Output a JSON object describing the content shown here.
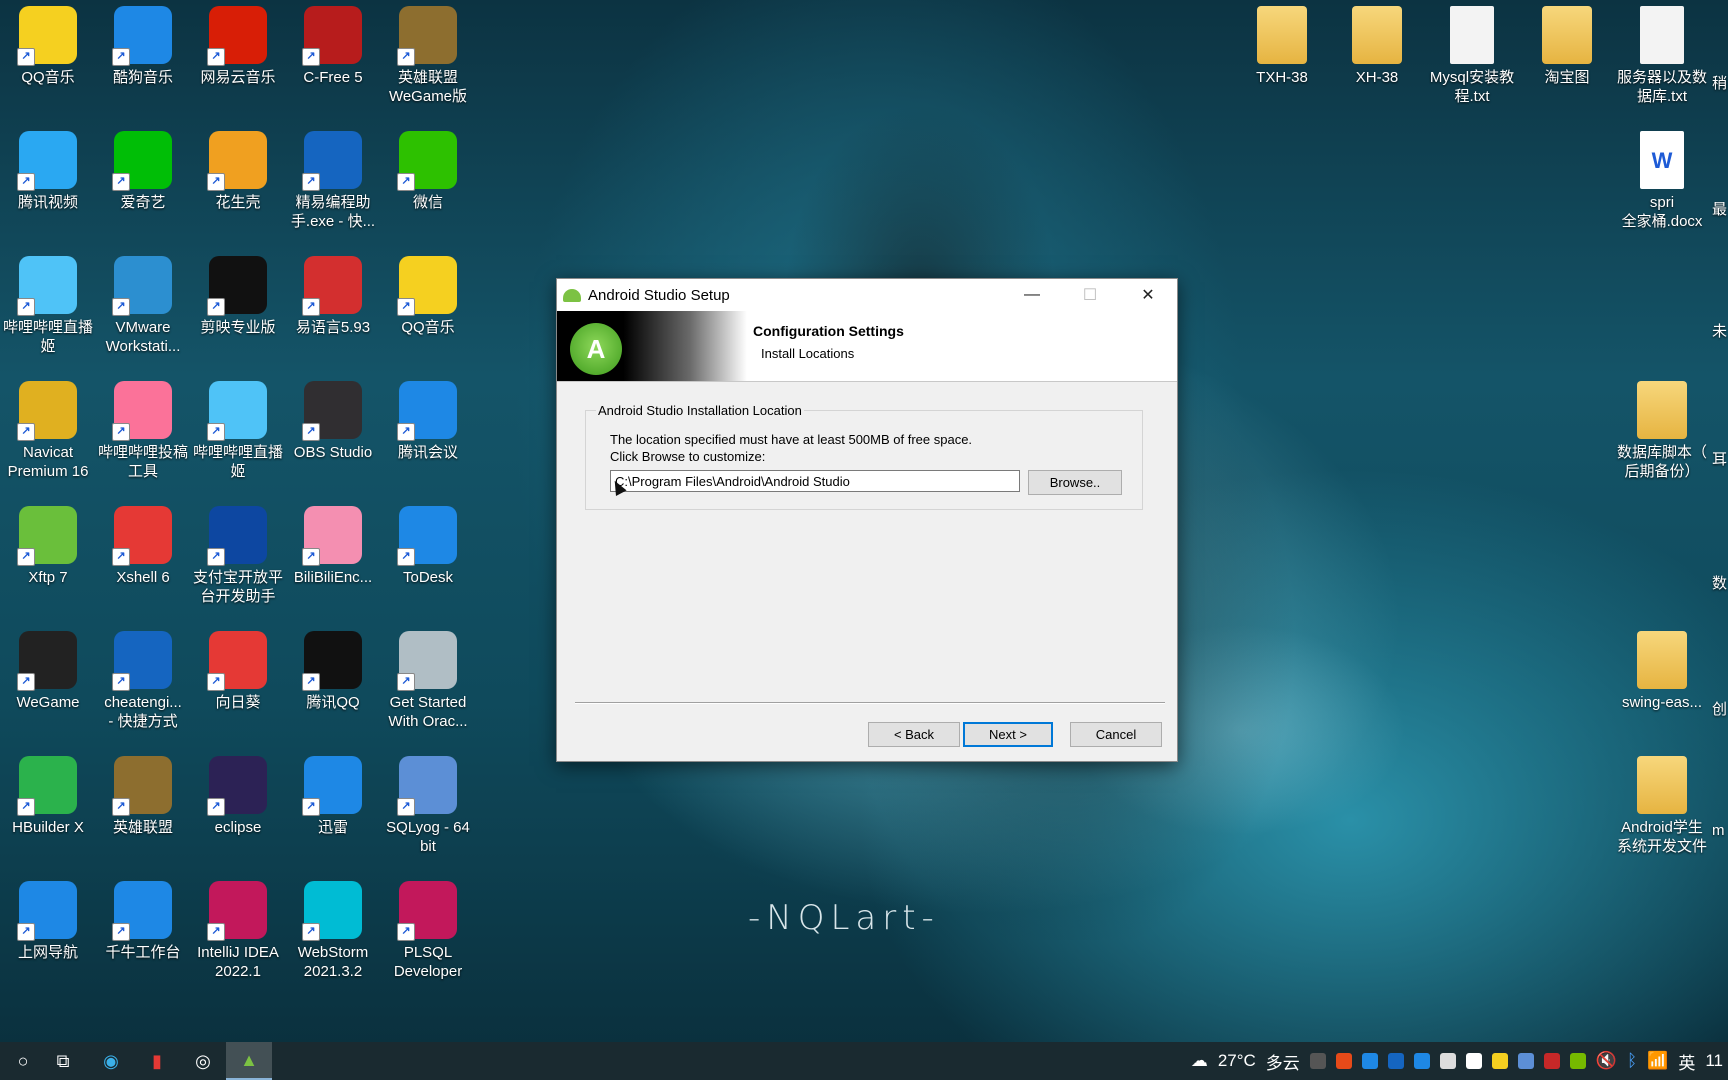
{
  "desktop": {
    "wallpaper_text": "-NQLart-",
    "left_icons": [
      {
        "label": "QQ音乐",
        "icon": "qq-music-icon",
        "color": "#f5d020"
      },
      {
        "label": "酷狗音乐",
        "icon": "kugou-music-icon",
        "color": "#1e88e5"
      },
      {
        "label": "网易云音乐",
        "icon": "netease-music-icon",
        "color": "#d81e06"
      },
      {
        "label": "C-Free 5",
        "icon": "cfree-icon",
        "color": "#b71c1c"
      },
      {
        "label": "英雄联盟\nWeGame版",
        "icon": "lol-wegame-icon",
        "color": "#8d6e2f"
      },
      {
        "label": "腾讯视频",
        "icon": "tencent-video-icon",
        "color": "#2aa8f2"
      },
      {
        "label": "爱奇艺",
        "icon": "iqiyi-icon",
        "color": "#00be06"
      },
      {
        "label": "花生壳",
        "icon": "oray-icon",
        "color": "#f0a020"
      },
      {
        "label": "精易编程助\n手.exe - 快...",
        "icon": "jingyi-icon",
        "color": "#1565c0"
      },
      {
        "label": "微信",
        "icon": "wechat-icon",
        "color": "#2dc100"
      },
      {
        "label": "哔哩哔哩直播\n姬",
        "icon": "bilibili-live-icon",
        "color": "#4fc3f7"
      },
      {
        "label": "VMware\nWorkstati...",
        "icon": "vmware-icon",
        "color": "#2c8fd0"
      },
      {
        "label": "剪映专业版",
        "icon": "jianying-icon",
        "color": "#111111"
      },
      {
        "label": "易语言5.93",
        "icon": "eyuyan-icon",
        "color": "#d32f2f"
      },
      {
        "label": "QQ音乐",
        "icon": "qq-music-icon",
        "color": "#f5d020"
      },
      {
        "label": "Navicat\nPremium 16",
        "icon": "navicat-icon",
        "color": "#e0b020"
      },
      {
        "label": "哔哩哔哩投稿\n工具",
        "icon": "bilibili-upload-icon",
        "color": "#fb7299"
      },
      {
        "label": "哔哩哔哩直播\n姬",
        "icon": "bilibili-live-icon",
        "color": "#4fc3f7"
      },
      {
        "label": "OBS Studio",
        "icon": "obs-icon",
        "color": "#302e31"
      },
      {
        "label": "腾讯会议",
        "icon": "tencent-meeting-icon",
        "color": "#1e88e5"
      },
      {
        "label": "Xftp 7",
        "icon": "xftp-icon",
        "color": "#6abf3b"
      },
      {
        "label": "Xshell 6",
        "icon": "xshell-icon",
        "color": "#e53935"
      },
      {
        "label": "支付宝开放平\n台开发助手",
        "icon": "alipay-dev-icon",
        "color": "#0d47a1"
      },
      {
        "label": "BiliBiliEnc...",
        "icon": "bilibili-enc-icon",
        "color": "#f48fb1"
      },
      {
        "label": "ToDesk",
        "icon": "todesk-icon",
        "color": "#1e88e5"
      },
      {
        "label": "WeGame",
        "icon": "wegame-icon",
        "color": "#222222"
      },
      {
        "label": "cheatengi...\n- 快捷方式",
        "icon": "cheatengine-icon",
        "color": "#1565c0"
      },
      {
        "label": "向日葵",
        "icon": "sunlogin-icon",
        "color": "#e53935"
      },
      {
        "label": "腾讯QQ",
        "icon": "qq-icon",
        "color": "#111111"
      },
      {
        "label": "Get Started\nWith Orac...",
        "icon": "oracle-icon",
        "color": "#b0bec5"
      },
      {
        "label": "HBuilder X",
        "icon": "hbuilder-icon",
        "color": "#2bb24c"
      },
      {
        "label": "英雄联盟",
        "icon": "lol-icon",
        "color": "#8d6e2f"
      },
      {
        "label": "eclipse",
        "icon": "eclipse-icon",
        "color": "#2c2255"
      },
      {
        "label": "迅雷",
        "icon": "xunlei-icon",
        "color": "#1e88e5"
      },
      {
        "label": "SQLyog - 64\nbit",
        "icon": "sqlyog-icon",
        "color": "#5c8fd6"
      },
      {
        "label": "上网导航",
        "icon": "ie-icon",
        "color": "#1e88e5"
      },
      {
        "label": "千牛工作台",
        "icon": "qianniu-icon",
        "color": "#1e88e5"
      },
      {
        "label": "IntelliJ IDEA\n2022.1",
        "icon": "intellij-icon",
        "color": "#c2185b"
      },
      {
        "label": "WebStorm\n2021.3.2",
        "icon": "webstorm-icon",
        "color": "#00bcd4"
      },
      {
        "label": "PLSQL\nDeveloper",
        "icon": "plsql-icon",
        "color": "#c2185b"
      }
    ],
    "right_icons": [
      {
        "label": "TXH-38",
        "icon": "folder-icon",
        "kind": "folder"
      },
      {
        "label": "XH-38",
        "icon": "folder-icon",
        "kind": "folder"
      },
      {
        "label": "Mysql安装教\n程.txt",
        "icon": "text-file-icon",
        "kind": "file"
      },
      {
        "label": "淘宝图",
        "icon": "psd-folder-icon",
        "kind": "folder"
      },
      {
        "label": "服务器以及数\n据库.txt",
        "icon": "text-file-icon",
        "kind": "file"
      },
      {
        "label": "spri\n全家桶.docx",
        "icon": "word-file-icon",
        "kind": "file"
      },
      {
        "label": "数据库脚本（\n后期备份）",
        "icon": "folder-icon",
        "kind": "folder"
      },
      {
        "label": "swing-eas...",
        "icon": "folder-icon",
        "kind": "folder"
      },
      {
        "label": "Android学生\n系统开发文件",
        "icon": "folder-icon",
        "kind": "folder"
      }
    ],
    "edge_labels": [
      "稍",
      "最",
      "未",
      "耳",
      "数",
      "创",
      "m"
    ]
  },
  "dialog": {
    "title": "Android Studio Setup",
    "header_title": "Configuration Settings",
    "header_subtitle": "Install Locations",
    "group_label": "Android Studio Installation Location",
    "desc_line1": "The location specified must have at least 500MB of free space.",
    "desc_line2": "Click Browse to customize:",
    "path_value": "C:\\Program Files\\Android\\Android Studio",
    "browse_label": "Browse..",
    "back_label": "< Back",
    "next_label": "Next >",
    "cancel_label": "Cancel",
    "minimize": "—",
    "maximize": "☐",
    "close": "✕"
  },
  "taskbar": {
    "weather_temp": "27°C",
    "weather_desc": "多云",
    "ime": "英",
    "clock_partial": "11",
    "volume": "🔇"
  }
}
